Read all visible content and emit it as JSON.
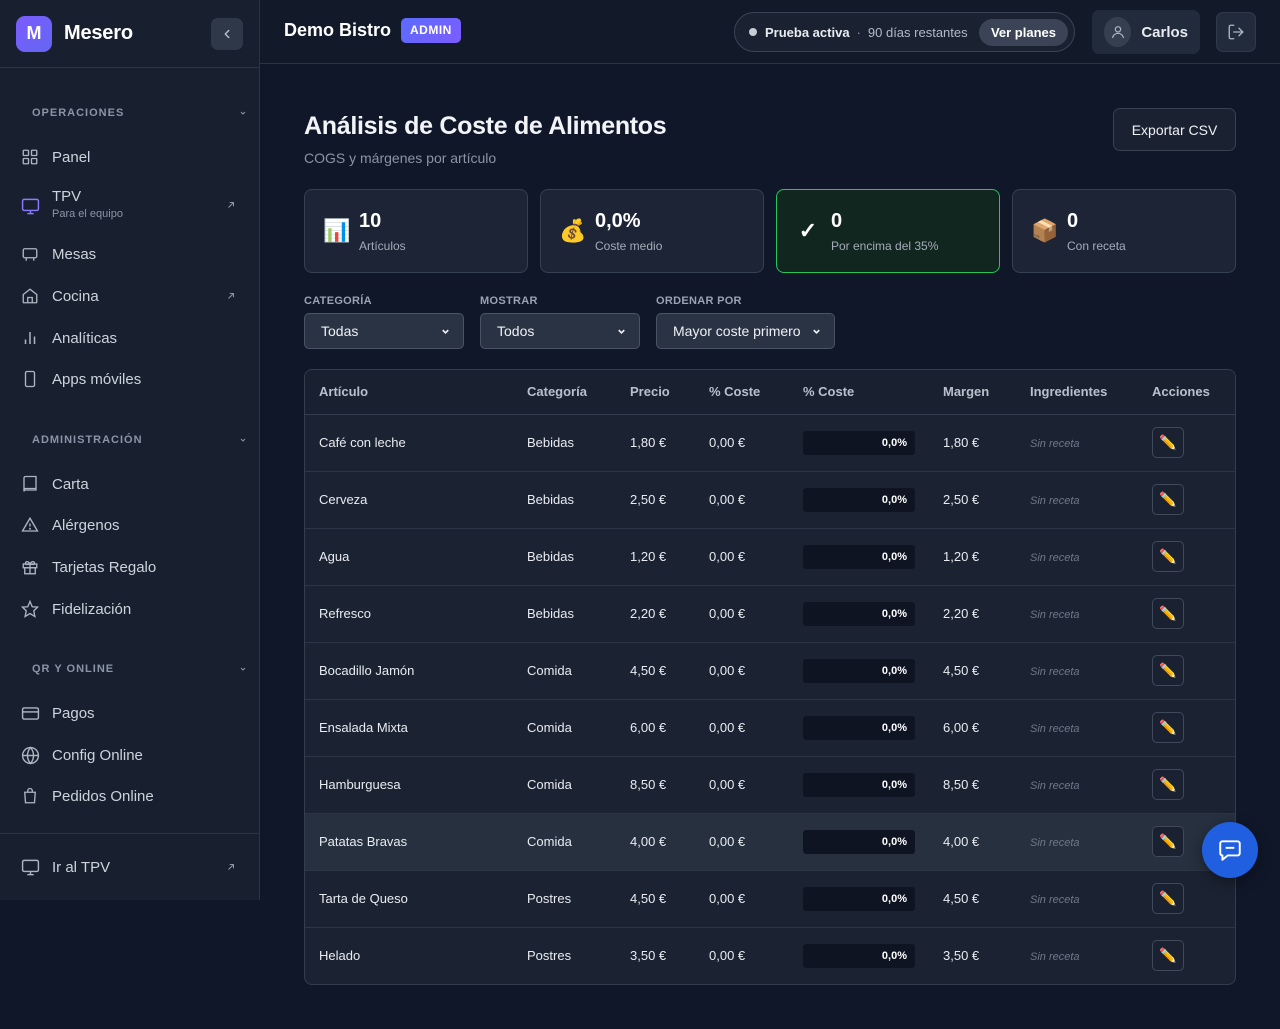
{
  "brand": {
    "logo_letter": "M",
    "name": "Mesero"
  },
  "sidebar": {
    "sections": [
      {
        "title": "OPERACIONES"
      },
      {
        "title": "ADMINISTRACIÓN"
      },
      {
        "title": "QR Y ONLINE"
      }
    ],
    "items": [
      {
        "label": "Panel",
        "icon": "grid-icon"
      },
      {
        "label": "TPV",
        "sublabel": "Para el equipo",
        "icon": "monitor-icon",
        "external": true
      },
      {
        "label": "Mesas",
        "icon": "table-icon"
      },
      {
        "label": "Cocina",
        "icon": "home-icon",
        "external": true
      },
      {
        "label": "Analíticas",
        "icon": "bar-chart-icon"
      },
      {
        "label": "Apps móviles",
        "icon": "smartphone-icon"
      },
      {
        "label": "Carta",
        "icon": "book-icon"
      },
      {
        "label": "Alérgenos",
        "icon": "warning-icon"
      },
      {
        "label": "Tarjetas Regalo",
        "icon": "gift-icon"
      },
      {
        "label": "Fidelización",
        "icon": "star-icon"
      },
      {
        "label": "Pagos",
        "icon": "credit-card-icon"
      },
      {
        "label": "Config Online",
        "icon": "globe-icon"
      },
      {
        "label": "Pedidos Online",
        "icon": "shopping-bag-icon"
      }
    ],
    "bottom": {
      "label": "Ir al TPV",
      "icon": "monitor-icon"
    }
  },
  "topbar": {
    "restaurant": "Demo Bistro",
    "role_badge": "ADMIN",
    "trial_status": "Prueba activa",
    "trial_separator": "·",
    "trial_days": "90 días restantes",
    "plans_button": "Ver planes",
    "user_name": "Carlos"
  },
  "page": {
    "title": "Análisis de Coste de Alimentos",
    "subtitle": "COGS y márgenes por artículo",
    "export_button": "Exportar CSV"
  },
  "stats": [
    {
      "emoji": "📊",
      "value": "10",
      "label": "Artículos"
    },
    {
      "emoji": "💰",
      "value": "0,0%",
      "label": "Coste medio"
    },
    {
      "emoji": "✓",
      "value": "0",
      "label": "Por encima del 35%"
    },
    {
      "emoji": "📦",
      "value": "0",
      "label": "Con receta"
    }
  ],
  "filters": {
    "category": {
      "label": "CATEGORÍA",
      "value": "Todas"
    },
    "show": {
      "label": "MOSTRAR",
      "value": "Todos"
    },
    "sort": {
      "label": "ORDENAR POR",
      "value": "Mayor coste primero"
    }
  },
  "table": {
    "headers": [
      "Artículo",
      "Categoría",
      "Precio",
      "% Coste",
      "% Coste",
      "Margen",
      "Ingredientes",
      "Acciones"
    ],
    "rows": [
      {
        "item": "Café con leche",
        "category": "Bebidas",
        "price": "1,80 €",
        "cost": "0,00 €",
        "cost_pct": "0,0%",
        "margin": "1,80 €",
        "ingredients": "Sin receta"
      },
      {
        "item": "Cerveza",
        "category": "Bebidas",
        "price": "2,50 €",
        "cost": "0,00 €",
        "cost_pct": "0,0%",
        "margin": "2,50 €",
        "ingredients": "Sin receta"
      },
      {
        "item": "Agua",
        "category": "Bebidas",
        "price": "1,20 €",
        "cost": "0,00 €",
        "cost_pct": "0,0%",
        "margin": "1,20 €",
        "ingredients": "Sin receta"
      },
      {
        "item": "Refresco",
        "category": "Bebidas",
        "price": "2,20 €",
        "cost": "0,00 €",
        "cost_pct": "0,0%",
        "margin": "2,20 €",
        "ingredients": "Sin receta"
      },
      {
        "item": "Bocadillo Jamón",
        "category": "Comida",
        "price": "4,50 €",
        "cost": "0,00 €",
        "cost_pct": "0,0%",
        "margin": "4,50 €",
        "ingredients": "Sin receta"
      },
      {
        "item": "Ensalada Mixta",
        "category": "Comida",
        "price": "6,00 €",
        "cost": "0,00 €",
        "cost_pct": "0,0%",
        "margin": "6,00 €",
        "ingredients": "Sin receta"
      },
      {
        "item": "Hamburguesa",
        "category": "Comida",
        "price": "8,50 €",
        "cost": "0,00 €",
        "cost_pct": "0,0%",
        "margin": "8,50 €",
        "ingredients": "Sin receta"
      },
      {
        "item": "Patatas Bravas",
        "category": "Comida",
        "price": "4,00 €",
        "cost": "0,00 €",
        "cost_pct": "0,0%",
        "margin": "4,00 €",
        "ingredients": "Sin receta"
      },
      {
        "item": "Tarta de Queso",
        "category": "Postres",
        "price": "4,50 €",
        "cost": "0,00 €",
        "cost_pct": "0,0%",
        "margin": "4,50 €",
        "ingredients": "Sin receta"
      },
      {
        "item": "Helado",
        "category": "Postres",
        "price": "3,50 €",
        "cost": "0,00 €",
        "cost_pct": "0,0%",
        "margin": "3,50 €",
        "ingredients": "Sin receta"
      }
    ],
    "edit_icon": "pencil-icon"
  },
  "colors": {
    "accent": "#6366f1",
    "highlight_border": "#22c55e",
    "chat_button": "#1f5fe0"
  }
}
